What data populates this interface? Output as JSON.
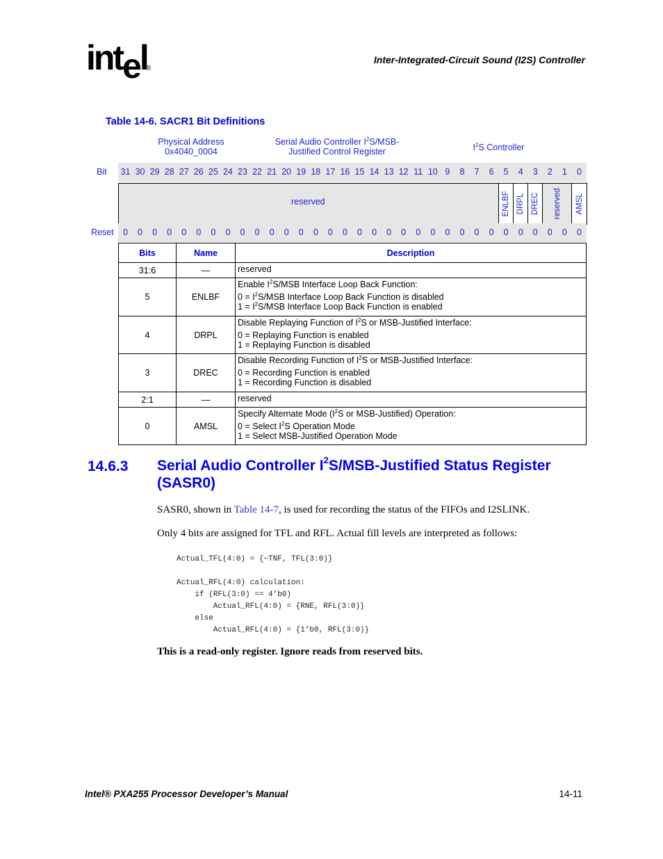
{
  "header": {
    "logo_text": "int",
    "logo_e": "e",
    "logo_l": "l",
    "logo_reg": "®",
    "running_title": "Inter-Integrated-Circuit Sound (I2S) Controller"
  },
  "table_caption": "Table 14-6. SACR1 Bit Definitions",
  "register_header": {
    "address_label": "Physical Address",
    "address_value": "0x4040_0004",
    "register_name_line1_pre": "Serial Audio Controller I",
    "register_name_line1_sup": "2",
    "register_name_line1_post": "S/MSB-",
    "register_name_line2": "Justified Control Register",
    "unit_pre": "I",
    "unit_sup": "2",
    "unit_post": "S Controller"
  },
  "bit_row": {
    "label": "Bit",
    "bits": [
      "31",
      "30",
      "29",
      "28",
      "27",
      "26",
      "25",
      "24",
      "23",
      "22",
      "21",
      "20",
      "19",
      "18",
      "17",
      "16",
      "15",
      "14",
      "13",
      "12",
      "11",
      "10",
      "9",
      "8",
      "7",
      "6",
      "5",
      "4",
      "3",
      "2",
      "1",
      "0"
    ]
  },
  "fields": {
    "reserved_label": "reserved",
    "named": [
      "ENLBF",
      "DRPL",
      "DREC",
      "reserved",
      "AMSL"
    ]
  },
  "reset_row": {
    "label": "Reset",
    "values": [
      "0",
      "0",
      "0",
      "0",
      "0",
      "0",
      "0",
      "0",
      "0",
      "0",
      "0",
      "0",
      "0",
      "0",
      "0",
      "0",
      "0",
      "0",
      "0",
      "0",
      "0",
      "0",
      "0",
      "0",
      "0",
      "0",
      "0",
      "0",
      "0",
      "0",
      "0",
      "0"
    ]
  },
  "defs_table": {
    "headers": {
      "bits": "Bits",
      "name": "Name",
      "description": "Description"
    },
    "rows": [
      {
        "bits": "31:6",
        "name": "—",
        "desc_head": "reserved"
      },
      {
        "bits": "5",
        "name": "ENLBF",
        "desc_head_pre": "Enable I",
        "desc_head_sup": "2",
        "desc_head_post": "S/MSB Interface Loop Back Function:",
        "line0_pre": "0 =  I",
        "line0_sup": "2",
        "line0_post": "S/MSB Interface Loop Back Function is disabled",
        "line1_pre": "1 =  I",
        "line1_sup": "2",
        "line1_post": "S/MSB Interface Loop Back Function is enabled"
      },
      {
        "bits": "4",
        "name": "DRPL",
        "desc_head_pre": "Disable Replaying Function of I",
        "desc_head_sup": "2",
        "desc_head_post": "S or MSB-Justified Interface:",
        "line0": "0 =  Replaying Function is enabled",
        "line1": "1 =  Replaying Function is disabled"
      },
      {
        "bits": "3",
        "name": "DREC",
        "desc_head_pre": "Disable Recording Function of I",
        "desc_head_sup": "2",
        "desc_head_post": "S or MSB-Justified Interface:",
        "line0": "0 =  Recording Function is enabled",
        "line1": "1 =  Recording Function is disabled"
      },
      {
        "bits": "2:1",
        "name": "—",
        "desc_head": "reserved"
      },
      {
        "bits": "0",
        "name": "AMSL",
        "desc_head_pre": "Specify Alternate Mode (I",
        "desc_head_sup": "2",
        "desc_head_post": "S or MSB-Justified) Operation:",
        "line0_pre": "0 =  Select I",
        "line0_sup": "2",
        "line0_post": "S Operation Mode",
        "line1": "1 =  Select MSB-Justified Operation Mode"
      }
    ]
  },
  "section": {
    "number": "14.6.3",
    "title_pre": "Serial Audio Controller I",
    "title_sup": "2",
    "title_post": "S/MSB-Justified Status Register (SASR0)"
  },
  "paragraphs": {
    "p1_pre": "SASR0, shown in ",
    "p1_link": "Table 14-7",
    "p1_post": ", is used for recording the status of the FIFOs and I2SLINK.",
    "p2": "Only 4 bits are assigned for TFL and RFL. Actual fill levels are interpreted as follows:"
  },
  "code": [
    "Actual_TFL(4:0) = {~TNF, TFL(3:0)}",
    "",
    "Actual_RFL(4:0) calculation:",
    "    if (RFL(3:0) == 4’b0)",
    "        Actual_RFL(4:0) = {RNE, RFL(3:0)}",
    "    else",
    "        Actual_RFL(4:0) = {1’b0, RFL(3:0)}"
  ],
  "note": "This is a read-only register. Ignore reads from reserved bits.",
  "footer": {
    "manual_title": "Intel® PXA255 Processor Developer’s Manual",
    "page_number": "14-11"
  }
}
